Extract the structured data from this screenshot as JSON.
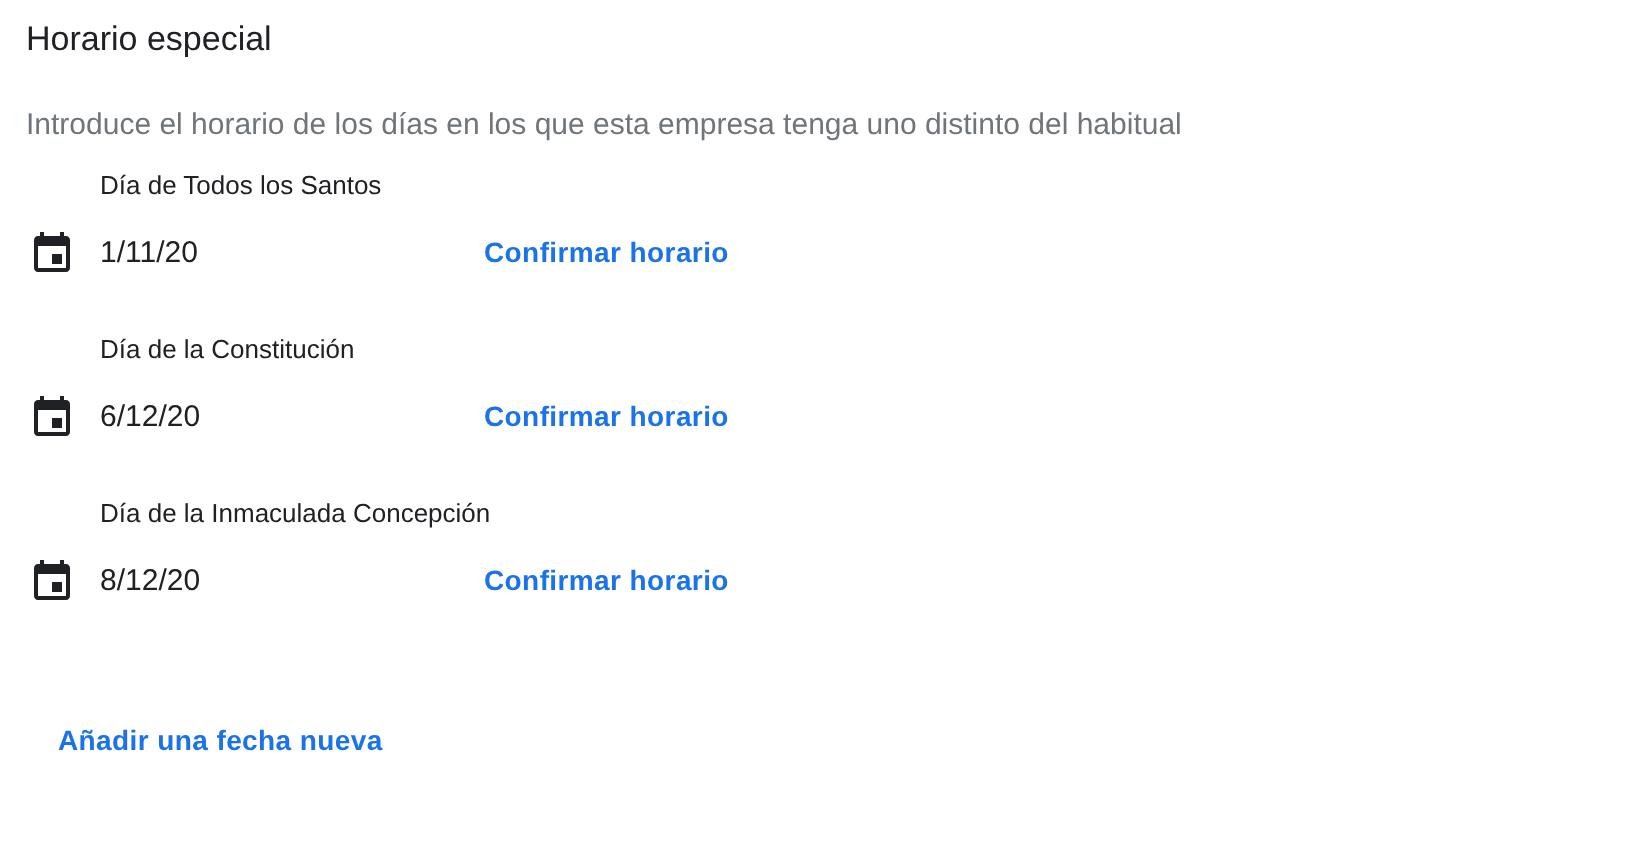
{
  "title": "Horario especial",
  "description": "Introduce el horario de los días en los que esta empresa tenga uno distinto del habitual",
  "dates": [
    {
      "name": "Día de Todos los Santos",
      "date": "1/11/20",
      "action": "Confirmar horario"
    },
    {
      "name": "Día de la Constitución",
      "date": "6/12/20",
      "action": "Confirmar horario"
    },
    {
      "name": "Día de la Inmaculada Concepción",
      "date": "8/12/20",
      "action": "Confirmar horario"
    }
  ],
  "add_link": "Añadir una fecha nueva"
}
